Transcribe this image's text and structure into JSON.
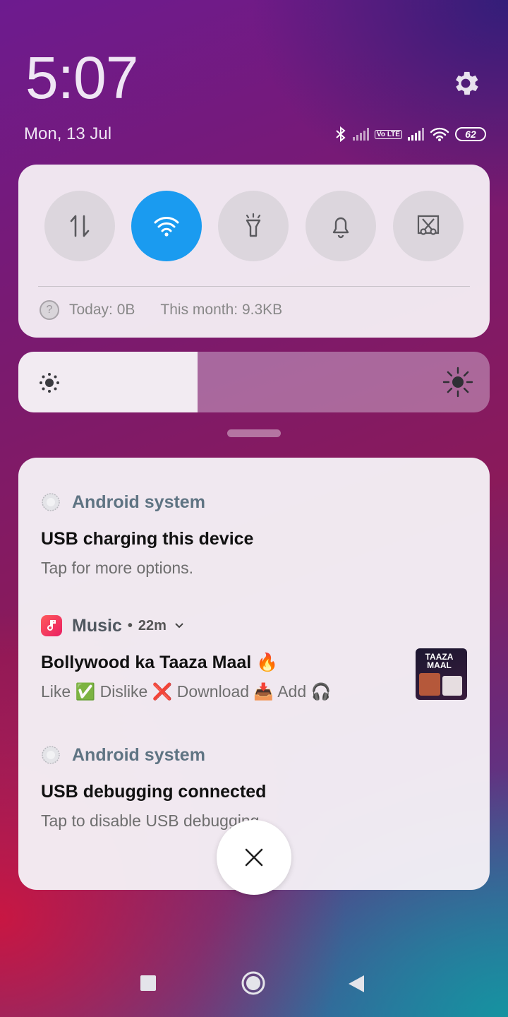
{
  "status": {
    "time": "5:07",
    "date": "Mon, 13 Jul",
    "battery": "62",
    "volte": "Vo LTE"
  },
  "quick_settings": {
    "tiles": [
      {
        "name": "mobile-data",
        "icon": "data-transfer-icon",
        "active": false
      },
      {
        "name": "wifi",
        "icon": "wifi-icon",
        "active": true
      },
      {
        "name": "flashlight",
        "icon": "flashlight-icon",
        "active": false
      },
      {
        "name": "sound",
        "icon": "bell-icon",
        "active": false
      },
      {
        "name": "screenshot",
        "icon": "scissors-screenshot-icon",
        "active": false
      }
    ],
    "usage_today": "Today: 0B",
    "usage_month": "This month: 9.3KB",
    "accent_color": "#1a9bf0"
  },
  "brightness": {
    "level": 0.38
  },
  "notifications": [
    {
      "app": "Android system",
      "title": "USB charging this device",
      "body": "Tap for more options."
    },
    {
      "app": "Music",
      "separator": "•",
      "time": "22m",
      "title": "Bollywood ka Taaza Maal 🔥",
      "body": "Like ✅ Dislike ❌ Download 📥 Add 🎧",
      "thumbnail_text": "TAAZA MAAL"
    },
    {
      "app": "Android system",
      "title": "USB debugging connected",
      "body": "Tap to disable USB debugging."
    }
  ],
  "controls": {
    "close": "close-icon"
  },
  "nav": {
    "items": [
      "recents-button",
      "home-button",
      "back-button"
    ]
  }
}
